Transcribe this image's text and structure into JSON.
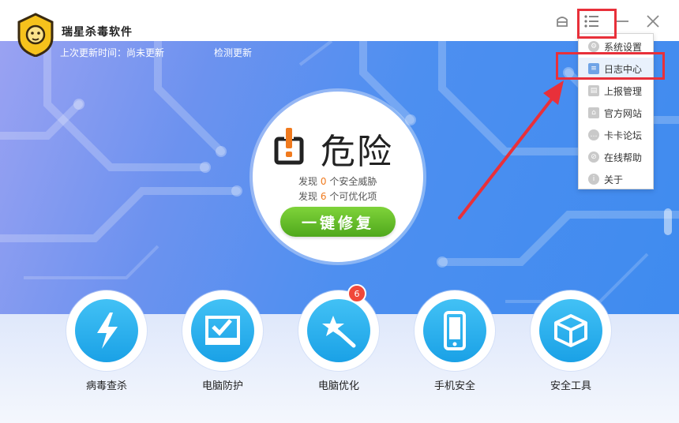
{
  "app": {
    "title": "瑞星杀毒软件"
  },
  "header": {
    "last_update": "上次更新时间：尚未更新",
    "check_update": "检测更新"
  },
  "status": {
    "text": "危险",
    "found": [
      {
        "prefix": "发现",
        "count": "0",
        "suffix": "个安全威胁"
      },
      {
        "prefix": "发现",
        "count": "6",
        "suffix": "个可优化项"
      }
    ],
    "fix_button": "一键修复"
  },
  "tools": [
    {
      "label": "病毒查杀",
      "icon": "lightning-icon"
    },
    {
      "label": "电脑防护",
      "icon": "monitor-check-icon"
    },
    {
      "label": "电脑优化",
      "icon": "star-wand-icon",
      "badge": "6"
    },
    {
      "label": "手机安全",
      "icon": "phone-icon"
    },
    {
      "label": "安全工具",
      "icon": "box-icon"
    }
  ],
  "menu": {
    "items": [
      {
        "label": "系统设置",
        "icon": "gear-icon"
      },
      {
        "label": "日志中心",
        "icon": "log-icon",
        "active": true
      },
      {
        "label": "上报管理",
        "icon": "report-icon"
      },
      {
        "label": "官方网站",
        "icon": "home-icon"
      },
      {
        "label": "卡卡论坛",
        "icon": "chat-icon"
      },
      {
        "label": "在线帮助",
        "icon": "help-icon"
      },
      {
        "label": "关于",
        "icon": "info-icon"
      }
    ]
  },
  "colors": {
    "accent_green": "#5db423",
    "danger_orange": "#f07a1e",
    "highlight_red": "#e8303a",
    "badge_red": "#f0483a"
  }
}
